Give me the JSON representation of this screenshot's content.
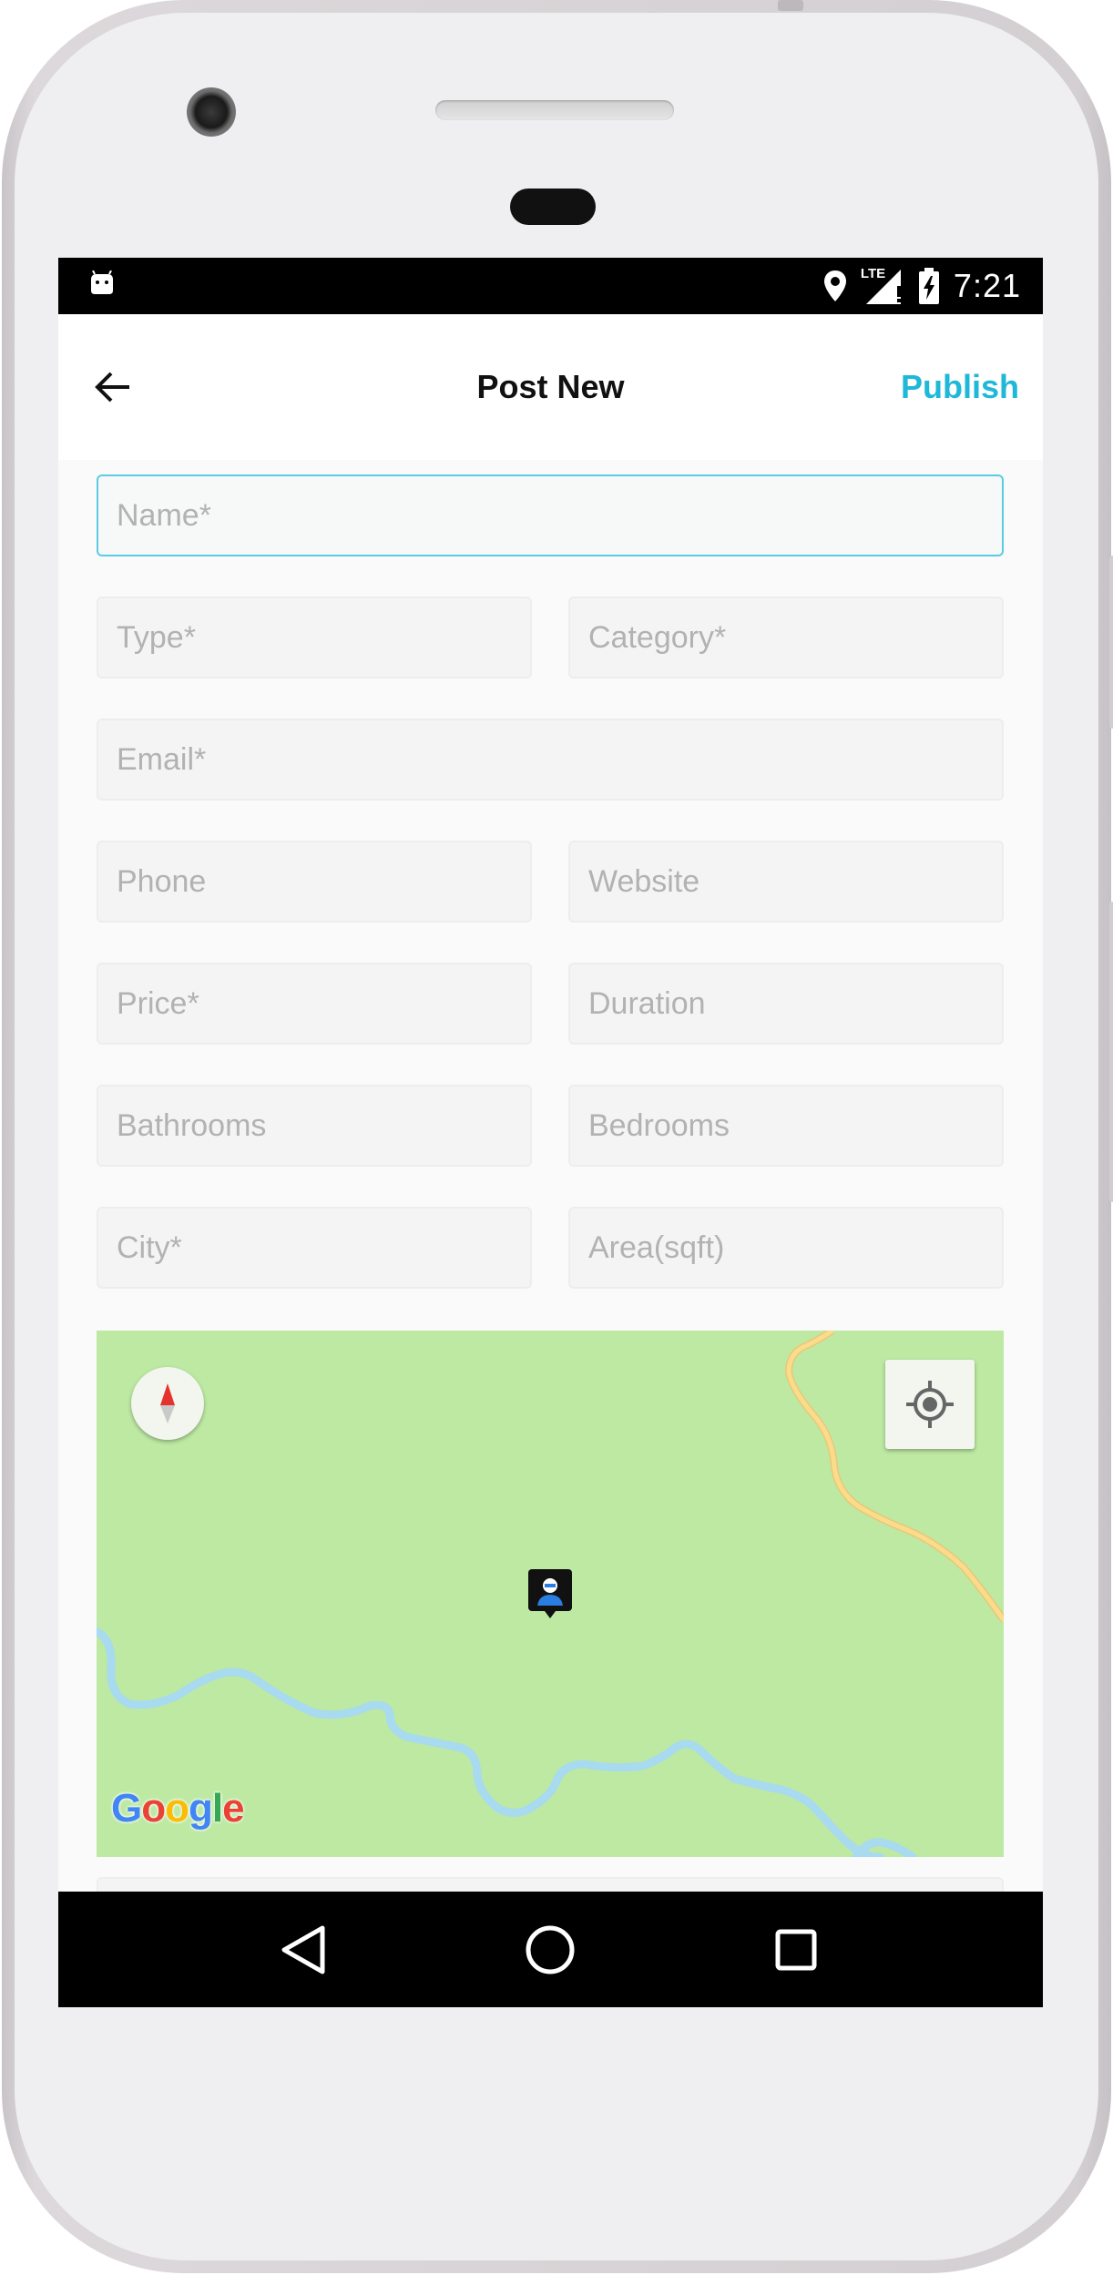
{
  "status_bar": {
    "time": "7:21",
    "network_label": "LTE",
    "icons": [
      "android-notification-icon",
      "location-icon",
      "signal-icon",
      "battery-charging-icon"
    ]
  },
  "app_bar": {
    "title": "Post New",
    "action_label": "Publish",
    "back_icon": "arrow-left-icon"
  },
  "form": {
    "fields": [
      {
        "name": "name",
        "placeholder": "Name*",
        "value": ""
      },
      {
        "name": "type",
        "placeholder": "Type*",
        "value": ""
      },
      {
        "name": "category",
        "placeholder": "Category*",
        "value": ""
      },
      {
        "name": "email",
        "placeholder": "Email*",
        "value": ""
      },
      {
        "name": "phone",
        "placeholder": "Phone",
        "value": ""
      },
      {
        "name": "website",
        "placeholder": "Website",
        "value": ""
      },
      {
        "name": "price",
        "placeholder": "Price*",
        "value": ""
      },
      {
        "name": "duration",
        "placeholder": "Duration",
        "value": ""
      },
      {
        "name": "bathrooms",
        "placeholder": "Bathrooms",
        "value": ""
      },
      {
        "name": "bedrooms",
        "placeholder": "Bedrooms",
        "value": ""
      },
      {
        "name": "city",
        "placeholder": "City*",
        "value": ""
      },
      {
        "name": "area",
        "placeholder": "Area(sqft)",
        "value": ""
      }
    ]
  },
  "map": {
    "attribution": "Google",
    "compass_icon": "compass-icon",
    "locate_icon": "my-location-icon",
    "marker_icon": "user-location-marker-icon"
  },
  "colors": {
    "accent": "#1fb8d8",
    "map_land": "#bde9a3",
    "map_water": "#a8daf0",
    "map_road": "#f6d27a"
  }
}
